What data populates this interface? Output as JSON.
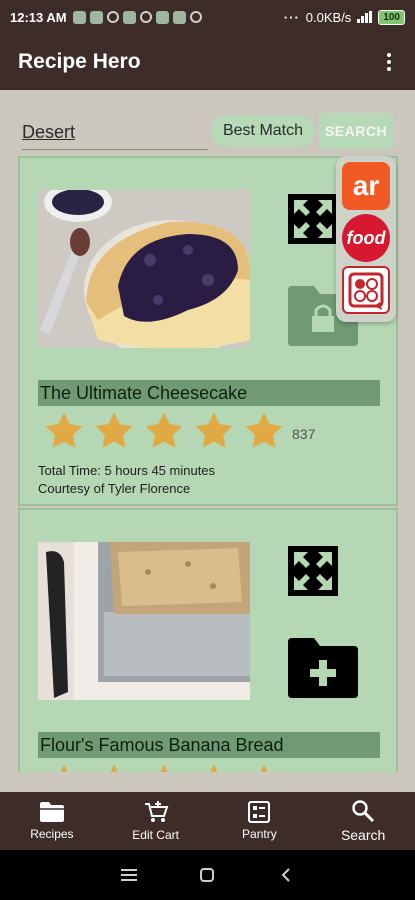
{
  "status_bar": {
    "time": "12:13 AM",
    "network_speed": "0.0KB/s",
    "battery": "100"
  },
  "app_bar": {
    "title": "Recipe Hero",
    "menu_icon": "more-vert-icon"
  },
  "search": {
    "query": "Desert",
    "sort_label": "Best Match",
    "button_label": "SEARCH"
  },
  "sources": [
    {
      "name": "allrecipes",
      "label": "ar",
      "color": "#f15a24"
    },
    {
      "name": "food-network",
      "label": "food",
      "color": "#d6192f"
    },
    {
      "name": "allquiet",
      "label": "",
      "color": "#c2272d"
    }
  ],
  "recipes": [
    {
      "name": "The Ultimate Cheesecake",
      "rating": 5,
      "review_count": "837",
      "total_time": "Total Time: 5 hours 45 minutes",
      "courtesy": "Courtesy of Tyler Florence",
      "folder_icon": "folder-lock-icon"
    },
    {
      "name": "Flour's Famous Banana Bread",
      "rating": 5,
      "folder_icon": "folder-add-icon"
    }
  ],
  "bottom_nav": [
    {
      "label": "Recipes",
      "icon": "folder-icon"
    },
    {
      "label": "Edit Cart",
      "icon": "cart-add-icon"
    },
    {
      "label": "Pantry",
      "icon": "pantry-icon"
    },
    {
      "label": "Search",
      "icon": "search-icon"
    }
  ],
  "colors": {
    "primary_dark": "#3d2c28",
    "card_green": "#b5d7b3",
    "title_band": "#6f9a73",
    "star": "#e0a943"
  }
}
